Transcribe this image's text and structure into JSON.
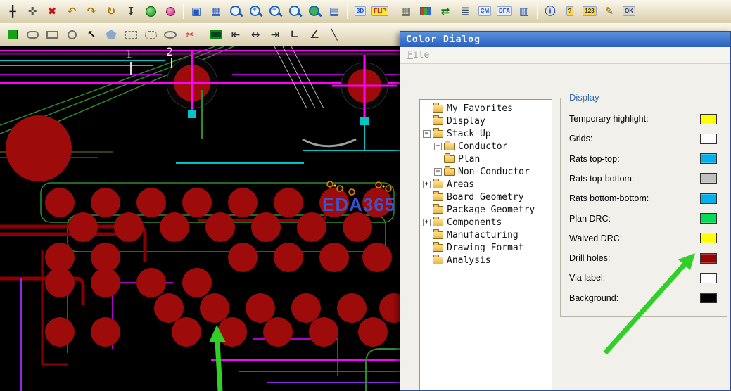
{
  "app": {
    "toolbar_row1": [
      {
        "name": "pan-icon",
        "glyph": "╋",
        "color": "#222222"
      },
      {
        "name": "move-element-icon",
        "glyph": "✜",
        "color": "#555555"
      },
      {
        "name": "delete-icon",
        "glyph": "✖",
        "color": "#cc1111"
      },
      {
        "name": "undo-icon",
        "glyph": "↶",
        "color": "#a87800"
      },
      {
        "name": "redo-icon",
        "glyph": "↷",
        "color": "#a87800"
      },
      {
        "name": "replay-icon",
        "glyph": "↻",
        "color": "#a87800"
      },
      {
        "name": "import-icon",
        "glyph": "↧",
        "color": "#333333"
      },
      {
        "name": "world-view-icon",
        "shape": "shape-globe"
      },
      {
        "name": "highlight-pick-icon",
        "shape": "shape-dot-pink"
      },
      {
        "sep": true
      },
      {
        "name": "open-window-icon",
        "glyph": "▣",
        "color": "#2357c5"
      },
      {
        "name": "tile-windows-icon",
        "glyph": "▦",
        "color": "#2357c5"
      },
      {
        "name": "zoom-area-icon",
        "shape": "shape-zoom"
      },
      {
        "name": "zoom-in-icon",
        "shape": "shape-zoom plus"
      },
      {
        "name": "zoom-out-icon",
        "shape": "shape-zoom minus"
      },
      {
        "name": "zoom-fit-icon",
        "shape": "shape-zoom"
      },
      {
        "name": "zoom-world-icon",
        "shape": "shape-zoom world"
      },
      {
        "name": "snapshot-icon",
        "glyph": "▤",
        "color": "#2357c5"
      },
      {
        "sep": true
      },
      {
        "name": "view-3d-icon",
        "badge": "3D",
        "bg": "#dfe9ff",
        "color": "#1b49c8"
      },
      {
        "name": "flip-board-icon",
        "badge": "FLIP",
        "bg": "#ffe93d",
        "color": "#c22222"
      },
      {
        "sep": true
      },
      {
        "name": "grid-toggle-icon",
        "glyph": "▦",
        "color": "#666666"
      },
      {
        "name": "color-palette-icon",
        "shape": "shape-palette"
      },
      {
        "name": "swap-layers-icon",
        "glyph": "⇄",
        "color": "#0a7a0a"
      },
      {
        "name": "layer-stack-icon",
        "glyph": "≣",
        "color": "#334a66"
      },
      {
        "name": "constraint-manager-icon",
        "badge": "CM",
        "bg": "#e8f0ff",
        "color": "#1b49c8"
      },
      {
        "name": "dfa-check-icon",
        "badge": "DFA",
        "bg": "#e8f0ff",
        "color": "#1b49c8"
      },
      {
        "name": "database-check-icon",
        "glyph": "▥",
        "color": "#2357c5"
      },
      {
        "sep": true
      },
      {
        "name": "info-icon",
        "glyph": "ⓘ",
        "color": "#1b49c8"
      },
      {
        "name": "help-icon",
        "badge": "?",
        "bg": "#ffd84d",
        "color": "#333333"
      },
      {
        "name": "numbers-display-icon",
        "badge": "123",
        "bg": "#ffd84d",
        "color": "#333333"
      },
      {
        "name": "markup-pen-icon",
        "glyph": "✎",
        "color": "#8a5a00"
      },
      {
        "name": "ok-gear-icon",
        "badge": "OK",
        "bg": "#d8d8d8",
        "color": "#333333"
      }
    ],
    "toolbar_row2": [
      {
        "name": "filled-rect-tool-icon",
        "shape": "shape-green-square"
      },
      {
        "name": "rounded-rect-tool-icon",
        "shape": "shape-roundrect"
      },
      {
        "name": "rect-tool-icon",
        "shape": "shape-rect"
      },
      {
        "name": "circle-tool-icon",
        "shape": "shape-circle"
      },
      {
        "name": "select-cursor-icon",
        "glyph": "↖",
        "color": "#111111"
      },
      {
        "name": "polygon-tool-icon",
        "shape": "shape-poly"
      },
      {
        "name": "rect-select-tool-icon",
        "shape": "shape-rect dashed"
      },
      {
        "name": "rounded-select-tool-icon",
        "shape": "shape-roundrect dashed"
      },
      {
        "name": "oval-tool-icon",
        "shape": "shape-oval"
      },
      {
        "name": "cut-tool-icon",
        "glyph": "✂",
        "color": "#cc2222"
      },
      {
        "sep": true
      },
      {
        "name": "board-outline-icon",
        "shape": "shape-board"
      },
      {
        "name": "dimension-left-icon",
        "glyph": "⇤",
        "color": "#333333"
      },
      {
        "name": "dimension-horizontal-icon",
        "glyph": "↔",
        "color": "#333333"
      },
      {
        "name": "dimension-right-icon",
        "glyph": "⇥",
        "color": "#333333"
      },
      {
        "name": "right-angle-icon",
        "glyph": "∟",
        "color": "#333333"
      },
      {
        "name": "angle-dimension-icon",
        "glyph": "∠",
        "color": "#333333"
      },
      {
        "name": "diagonal-line-icon",
        "glyph": "╲",
        "color": "#333333"
      }
    ]
  },
  "canvas": {
    "background": "#000000",
    "drill_color": "#9e0b0b",
    "watermark": "EDA365",
    "labels": [
      "1",
      "2"
    ]
  },
  "dialog": {
    "title": "Color Dialog",
    "menu": [
      {
        "label": "File"
      }
    ],
    "tree": [
      {
        "label": "My Favorites",
        "level": 0,
        "exp": null
      },
      {
        "label": "Display",
        "level": 0,
        "exp": null
      },
      {
        "label": "Stack-Up",
        "level": 0,
        "exp": "minus"
      },
      {
        "label": "Conductor",
        "level": 1,
        "exp": "plus"
      },
      {
        "label": "Plan",
        "level": 1,
        "exp": null
      },
      {
        "label": "Non-Conductor",
        "level": 1,
        "exp": "plus"
      },
      {
        "label": "Areas",
        "level": 0,
        "exp": "plus"
      },
      {
        "label": "Board Geometry",
        "level": 0,
        "exp": null
      },
      {
        "label": "Package Geometry",
        "level": 0,
        "exp": null
      },
      {
        "label": "Components",
        "level": 0,
        "exp": "plus"
      },
      {
        "label": "Manufacturing",
        "level": 0,
        "exp": null
      },
      {
        "label": "Drawing Format",
        "level": 0,
        "exp": null
      },
      {
        "label": "Analysis",
        "level": 0,
        "exp": null
      }
    ],
    "group_label": "Display",
    "swatches": [
      {
        "label": "Temporary highlight:",
        "color": "#ffff00"
      },
      {
        "label": "Grids:",
        "color": "#ffffff"
      },
      {
        "label": "Rats top-top:",
        "color": "#00b0ee"
      },
      {
        "label": "Rats top-bottom:",
        "color": "#c0c0c0"
      },
      {
        "label": "Rats bottom-bottom:",
        "color": "#00b0ee"
      },
      {
        "label": "Plan DRC:",
        "color": "#00dd55"
      },
      {
        "label": "Waived DRC:",
        "color": "#ffff00"
      },
      {
        "label": "Drill holes:",
        "color": "#990000"
      },
      {
        "label": "Via label:",
        "color": "#ffffff"
      },
      {
        "label": "Background:",
        "color": "#000000"
      }
    ]
  },
  "arrows": {
    "color": "#2fd028"
  }
}
